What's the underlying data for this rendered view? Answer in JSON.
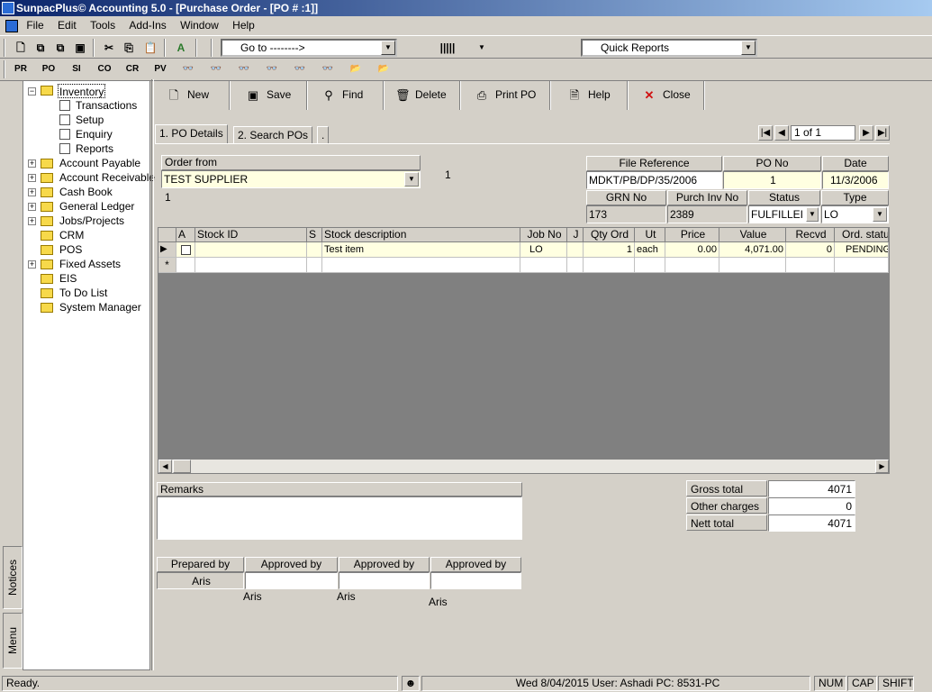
{
  "window": {
    "title": "SunpacPlus© Accounting 5.0 - [Purchase Order - [PO # :1]]"
  },
  "menu": [
    "File",
    "Edit",
    "Tools",
    "Add-Ins",
    "Window",
    "Help"
  ],
  "toolbar": {
    "goto": "Go to -------->",
    "quick_reports": "Quick Reports",
    "module_buttons": [
      "PR",
      "PO",
      "SI",
      "CO",
      "CR",
      "PV"
    ]
  },
  "left_tabs": {
    "notices": "Notices",
    "menu": "Menu"
  },
  "tree": {
    "inventory": "Inventory",
    "inventory_children": [
      "Transactions",
      "Setup",
      "Enquiry",
      "Reports"
    ],
    "modules": [
      {
        "label": "Account Payable",
        "expandable": true
      },
      {
        "label": "Account Receivable",
        "expandable": true
      },
      {
        "label": "Cash Book",
        "expandable": true
      },
      {
        "label": "General Ledger",
        "expandable": true
      },
      {
        "label": "Jobs/Projects",
        "expandable": true
      },
      {
        "label": "CRM",
        "expandable": false
      },
      {
        "label": "POS",
        "expandable": false
      },
      {
        "label": "Fixed Assets",
        "expandable": true
      },
      {
        "label": "EIS",
        "expandable": false
      },
      {
        "label": "To Do List",
        "expandable": false
      },
      {
        "label": "System Manager",
        "expandable": false
      }
    ]
  },
  "actions": {
    "new": "New",
    "save": "Save",
    "find": "Find",
    "delete": "Delete",
    "print": "Print PO",
    "help": "Help",
    "close": "Close"
  },
  "tabs": {
    "details": "1. PO Details",
    "search": "2. Search POs",
    "extra": "."
  },
  "record_nav": {
    "position": "1 of 1"
  },
  "order": {
    "label": "Order from",
    "supplier": "TEST SUPPLIER",
    "count_right": "1",
    "count_below": "1"
  },
  "header": {
    "file_ref_label": "File Reference",
    "file_ref": "MDKT/PB/DP/35/2006",
    "po_no_label": "PO No",
    "po_no": "1",
    "date_label": "Date",
    "date": "11/3/2006",
    "grn_label": "GRN No",
    "grn": "173",
    "inv_label": "Purch Inv No",
    "inv": "2389",
    "status_label": "Status",
    "status": "FULFILLEI",
    "type_label": "Type",
    "type": "LO"
  },
  "grid": {
    "columns": [
      "A",
      "Stock ID",
      "S",
      "Stock description",
      "Job No",
      "J",
      "Qty Ord",
      "Ut",
      "Price",
      "Value",
      "Recvd",
      "Ord. statu"
    ],
    "row": {
      "stock_id": "",
      "s": "",
      "desc": "Test item",
      "job": "LO",
      "j": "",
      "qty": "1",
      "ut": "each",
      "price": "0.00",
      "value": "4,071.00",
      "recvd": "0",
      "status": "PENDING"
    },
    "new_row_marker": "*",
    "current_row_marker": "▶"
  },
  "remarks": {
    "label": "Remarks",
    "value": ""
  },
  "totals": {
    "gross_label": "Gross total",
    "gross": "4071",
    "other_label": "Other charges",
    "other": "0",
    "nett_label": "Nett total",
    "nett": "4071"
  },
  "signoff": {
    "prepared_label": "Prepared by",
    "prepared": "Aris",
    "approved_label": "Approved by",
    "approved_values": [
      "",
      "",
      ""
    ],
    "below_names": [
      "Aris",
      "Aris",
      "Aris"
    ]
  },
  "statusbar": {
    "ready": "Ready.",
    "info": "Wed 8/04/2015 User: Ashadi PC: 8531-PC",
    "num": "NUM",
    "cap": "CAP",
    "shift": "SHIFT"
  }
}
